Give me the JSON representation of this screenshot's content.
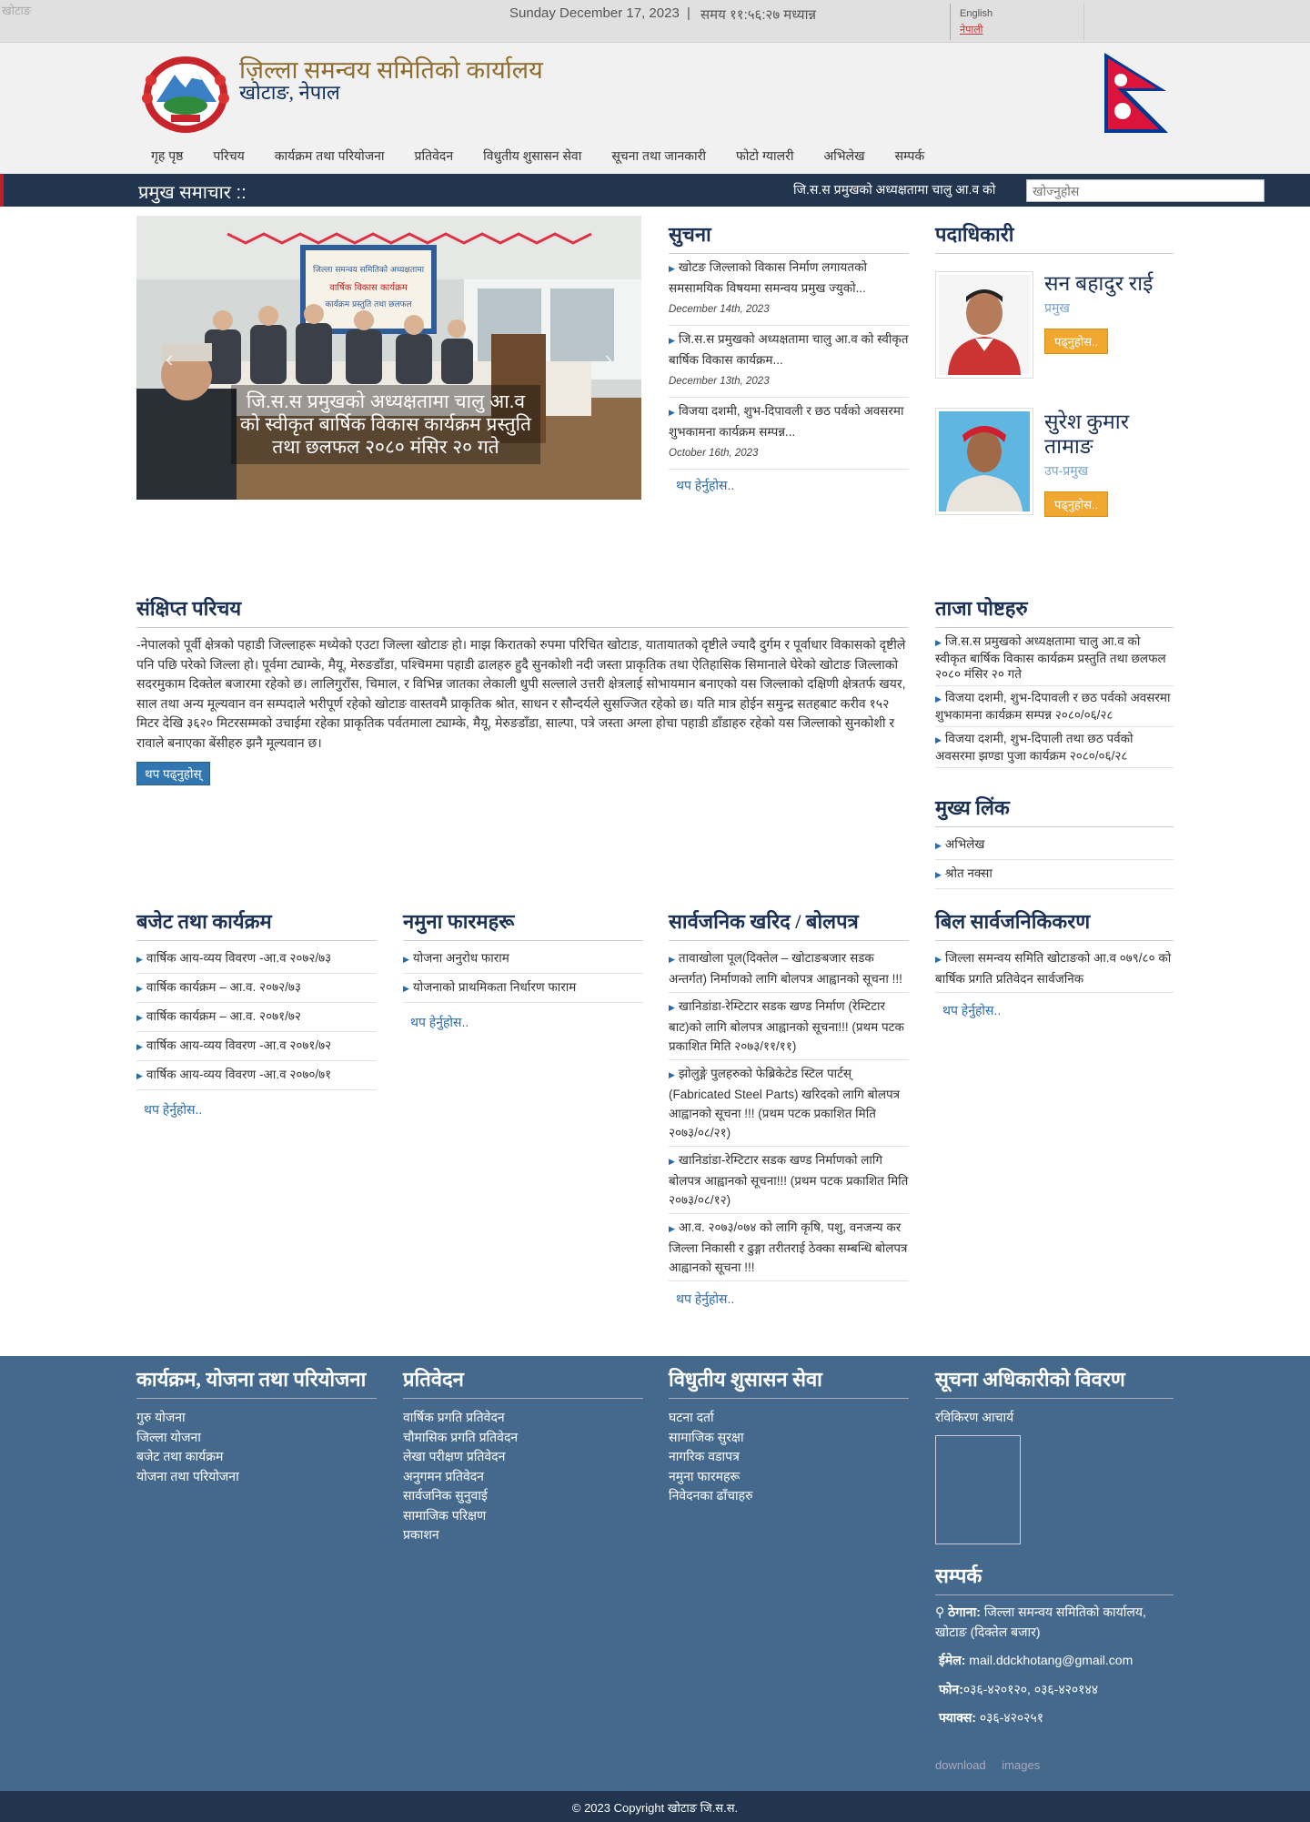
{
  "topbar": {
    "broken_logo_alt": "खोटाङ",
    "date": "Sunday December 17, 2023",
    "time": "समय ११:५६:२७ मध्यान्न",
    "lang_en": "English",
    "lang_ne": "नेपाली"
  },
  "header": {
    "title": "ज़िल्ला समन्वय समितिको कार्यालय",
    "subtitle": "खोटाङ, नेपाल"
  },
  "nav": [
    "गृह पृष्ठ",
    "परिचय",
    "कार्यक्रम तथा परियोजना",
    "प्रतिवेदन",
    "विधुतीय शुसासन सेवा",
    "सूचना तथा जानकारी",
    "फोटो ग्यालरी",
    "अभिलेख",
    "सम्पर्क"
  ],
  "newsbar": {
    "title": "प्रमुख समाचार ::",
    "ticker": "जि.स.स प्रमुखको अध्यक्षतामा चालु आ.व को",
    "search_placeholder": "खोज्नुहोस"
  },
  "slider": {
    "caption": "जि.स.स प्रमुखको अध्यक्षतामा चालु आ.व को स्वीकृत बार्षिक विकास कार्यक्रम प्रस्तुति तथा छलफल २०८० मंसिर २० गते",
    "banner_line1": "जिल्ला समन्वय समितिको अध्यक्षतामा",
    "banner_line2": "वार्षिक विकास कार्यक्रम",
    "banner_line3": "कार्यक्रम प्रस्तुति तथा छलफल"
  },
  "notice": {
    "heading": "सुचना",
    "items": [
      {
        "text": "खोटङ जिल्लाको विकास निर्माण लगायतको समसामयिक विषयमा समन्वय प्रमुख ज्युको...",
        "date": "December 14th, 2023"
      },
      {
        "text": "जि.स.स प्रमुखको अध्यक्षतामा चालु आ.व को स्वीकृत बार्षिक विकास कार्यक्रम...",
        "date": "December 13th, 2023"
      },
      {
        "text": "विजया दशमी, शुभ-दिपावली र छठ पर्वको अवसरमा शुभकामना कार्यक्रम सम्पन्न...",
        "date": "October 16th, 2023"
      }
    ],
    "more": "थप हेर्नुहोस.."
  },
  "officials": {
    "heading": "पदाधिकारी",
    "people": [
      {
        "name": "सन बहादुर राई",
        "role": "प्रमुख",
        "button": "पढ्नुहोस.."
      },
      {
        "name": "सुरेश कुमार तामाङ",
        "role": "उप-प्रमुख",
        "button": "पढ्नुहोस.."
      }
    ]
  },
  "intro": {
    "heading": "संक्षिप्त परिचय",
    "text": "-नेपालको पूर्वी क्षेत्रको पहाडी जिल्लाहरू मध्येको एउटा जिल्ला खोटाङ हो। माझ किरातको रुपमा परिचित खोटाङ, यातायातको दृष्टीले ज्यादै दुर्गम र पूर्वाधार विकासको दृष्टीले पनि पछि परेको जिल्ला हो। पूर्वमा ट्याम्के, मैयू, मेरुङडाँडा, पश्चिममा पहाडी ढालहरु हुदै सुनकोशी नदी जस्ता प्राकृतिक तथा ऐतिहासिक सिमानाले घेरेको खोटाङ जिल्लाको सदरमुकाम दिक्तेल बजारमा रहेको छ। लालिगुराँस, चिमाल, र विभिन्न जातका लेकाली धुपी सल्लाले उत्तरी क्षेत्रलाई सोभायमान बनाएको यस जिल्लाको दक्षिणी क्षेत्रतर्फ खयर, साल तथा अन्य मूल्यवान वन सम्पदाले भरीपूर्ण रहेको खोटाङ वास्तवमै प्राकृतिक श्रोत, साधन र सौन्दर्यले सुसज्जित रहेको छ। यति मात्र होईन समुन्द्र सतहबाट करीव १५२ मिटर देखि ३६२० मिटरसम्मको उचाईमा रहेका प्राकृतिक पर्वतमाला ट्याम्के, मैयू, मेरुङडाँडा, साल्पा, पत्रे जस्ता अग्ला होचा पहाडी डाँडाहरु रहेको यस जिल्लाको सुनकोशी र रावाले बनाएका बेंसीहरु झनै मूल्यवान छ।",
    "button": "थप पढ्नुहोस्"
  },
  "latest": {
    "heading": "ताजा पोष्टहरु",
    "items": [
      "जि.स.स प्रमुखको अध्यक्षतामा चालु आ.व को स्वीकृत बार्षिक विकास कार्यक्रम प्रस्तुति तथा छलफल २०८० मंसिर २० गते",
      "विजया दशमी, शुभ-दिपावली र छठ पर्वको अवसरमा शुभकामना कार्यक्रम सम्पन्न २०८०/०६/२८",
      "विजया दशमी, शुभ-दिपाली तथा छठ पर्वको अवसरमा झण्डा पुजा कार्यक्रम २०८०/०६/२८"
    ]
  },
  "main_links": {
    "heading": "मुख्य लिंक",
    "items": [
      "अभिलेख",
      "श्रोत नक्सा"
    ]
  },
  "budget": {
    "heading": "बजेट तथा कार्यक्रम",
    "items": [
      "वार्षिक आय-व्यय विवरण -आ.व २०७२/७३",
      "वार्षिक कार्यक्रम – आ.व. २०७२/७३",
      "वार्षिक कार्यक्रम – आ.व. २०७१/७२",
      "वार्षिक आय-व्यय विवरण -आ.व २०७१/७२",
      "वार्षिक आय-व्यय विवरण -आ.व २०७०/७१"
    ],
    "more": "थप हेर्नुहोस.."
  },
  "forms": {
    "heading": "नमुना फारमहरू",
    "items": [
      "योजना अनुरोध फाराम",
      "योजनाको प्राथमिकता निर्धारण फाराम"
    ],
    "more": "थप हेर्नुहोस.."
  },
  "procurement": {
    "heading": "सार्वजनिक खरिद / बोलपत्र",
    "items": [
      "तावाखोला पूल(दिक्तेल – खोटाङबजार सडक अन्तर्गत) निर्माणको लागि बोलपत्र आह्वानको सूचना !!!",
      "खानिडांडा-रेम्टिटार सडक खण्ड निर्माण (रेम्टिटार बाट)को लागि बोलपत्र आह्वानको सूचना!!! (प्रथम पटक प्रकाशित मिति २०७३/११/११)",
      "झोलुङ्गे पुलहरुको फेब्रिकेटेड स्टिल पार्टस् (Fabricated Steel Parts) खरिदको लागि बोलपत्र आह्वानको सूचना !!! (प्रथम पटक प्रकाशित मिति २०७३/०८/२१)",
      "खानिडांडा-रेम्टिटार सडक खण्ड निर्माणको लागि बोलपत्र आह्वानको सूचना!!! (प्रथम पटक प्रकाशित मिति २०७३/०८/१२)",
      "आ.व. २०७३/०७४ को लागि कृषि, पशु, वनजन्य कर जिल्ला निकासी र ढुङ्गा तरीतराई ठेक्का सम्बन्धि बोलपत्र आह्वानको सूचना !!!"
    ],
    "more": "थप हेर्नुहोस.."
  },
  "bills": {
    "heading": "बिल सार्वजनिकिकरण",
    "items": [
      "जिल्ला समन्वय समिति खोटाङको आ.व ०७९/८० को बार्षिक प्रगति प्रतिवेदन सार्वजनिक"
    ],
    "more": "थप हेर्नुहोस.."
  },
  "footer": {
    "programs": {
      "heading": "कार्यक्रम, योजना तथा परियोजना",
      "items": [
        "गुरु योजना",
        "जिल्ला योजना",
        "बजेट तथा कार्यक्रम",
        "योजना तथा परियोजना"
      ]
    },
    "reports": {
      "heading": "प्रतिवेदन",
      "items": [
        "वार्षिक प्रगति प्रतिवेदन",
        "चौमासिक प्रगति प्रतिवेदन",
        "लेखा परीक्षण प्रतिवेदन",
        "अनुगमन प्रतिवेदन",
        "सार्वजनिक सुनुवाई",
        "सामाजिक परिक्षण",
        "प्रकाशन"
      ]
    },
    "egov": {
      "heading": "विधुतीय शुसासन सेवा",
      "items": [
        "घटना दर्ता",
        "सामाजिक सुरक्षा",
        "नागरिक वडापत्र",
        "नमुना फारमहरू",
        "निवेदनका ढाँचाहरु"
      ]
    },
    "info_officer": {
      "heading": "सूचना अधिकारीको विवरण",
      "name": "रविकिरण आचार्य"
    },
    "contact": {
      "heading": "सम्पर्क",
      "address_label": "ठेगाना:",
      "address": "जिल्ला समन्वय समितिको कार्यालय, खोटाङ (दिक्तेल बजार)",
      "email_label": "ईमेल:",
      "email": "mail.ddckhotang@gmail.com",
      "phone_label": "फोन:",
      "phone": "०३६-४२०१२०, ०३६-४२०१४४",
      "fax_label": "फ्याक्स:",
      "fax": "०३६-४२०२५१"
    },
    "badge1_alt": "download",
    "badge2_alt": "images"
  },
  "copyright": "© 2023 Copyright खोटाङ जि.स.स.",
  "colors": {
    "primary": "#22354e",
    "footer": "#45698d",
    "accent": "#f0a830",
    "link": "#2a6aa8",
    "heading": "#1c3254",
    "title_gold": "#8e6d2e"
  }
}
